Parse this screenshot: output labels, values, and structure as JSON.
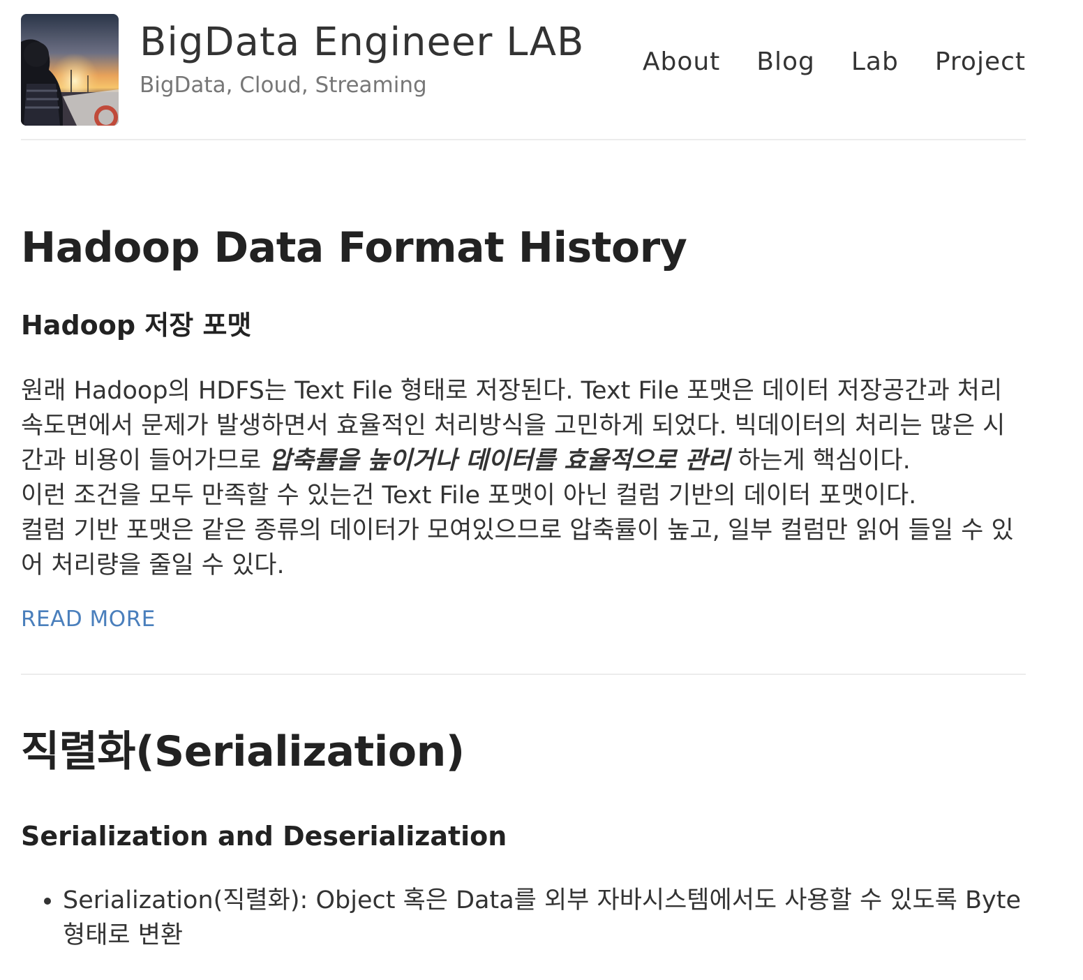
{
  "header": {
    "site_title": "BigData Engineer LAB",
    "site_subtitle": "BigData, Cloud, Streaming",
    "nav": [
      {
        "label": "About"
      },
      {
        "label": "Blog"
      },
      {
        "label": "Lab"
      },
      {
        "label": "Project"
      }
    ]
  },
  "posts": [
    {
      "title": "Hadoop Data Format History",
      "heading": "Hadoop 저장 포맷",
      "paragraph_line1_pre": "원래 Hadoop의 HDFS는 Text File 형태로 저장된다. Text File 포맷은 데이터 저장공간과 처리 속도면에서 문제가 발생하면서 효율적인 처리방식을 고민하게 되었다. 빅데이터의 처리는 많은 시간과 비용이 들어가므로 ",
      "paragraph_emphasis": "압축률을 높이거나 데이터를 효율적으로 관리",
      "paragraph_line1_post": " 하는게 핵심이다.",
      "paragraph_line2": "이런 조건을 모두 만족할 수 있는건 Text File 포맷이 아닌 컬럼 기반의 데이터 포맷이다.",
      "paragraph_line3": "컬럼 기반 포맷은 같은 종류의 데이터가 모여있으므로 압축률이 높고, 일부 컬럼만 읽어 들일 수 있어 처리량을 줄일 수 있다.",
      "read_more": "READ MORE"
    },
    {
      "title": "직렬화(Serialization)",
      "heading": "Serialization and Deserialization",
      "bullets": [
        "Serialization(직렬화): Object 혹은 Data를 외부 자바시스템에서도 사용할 수 있도록 Byte 형태로 변환"
      ]
    }
  ]
}
